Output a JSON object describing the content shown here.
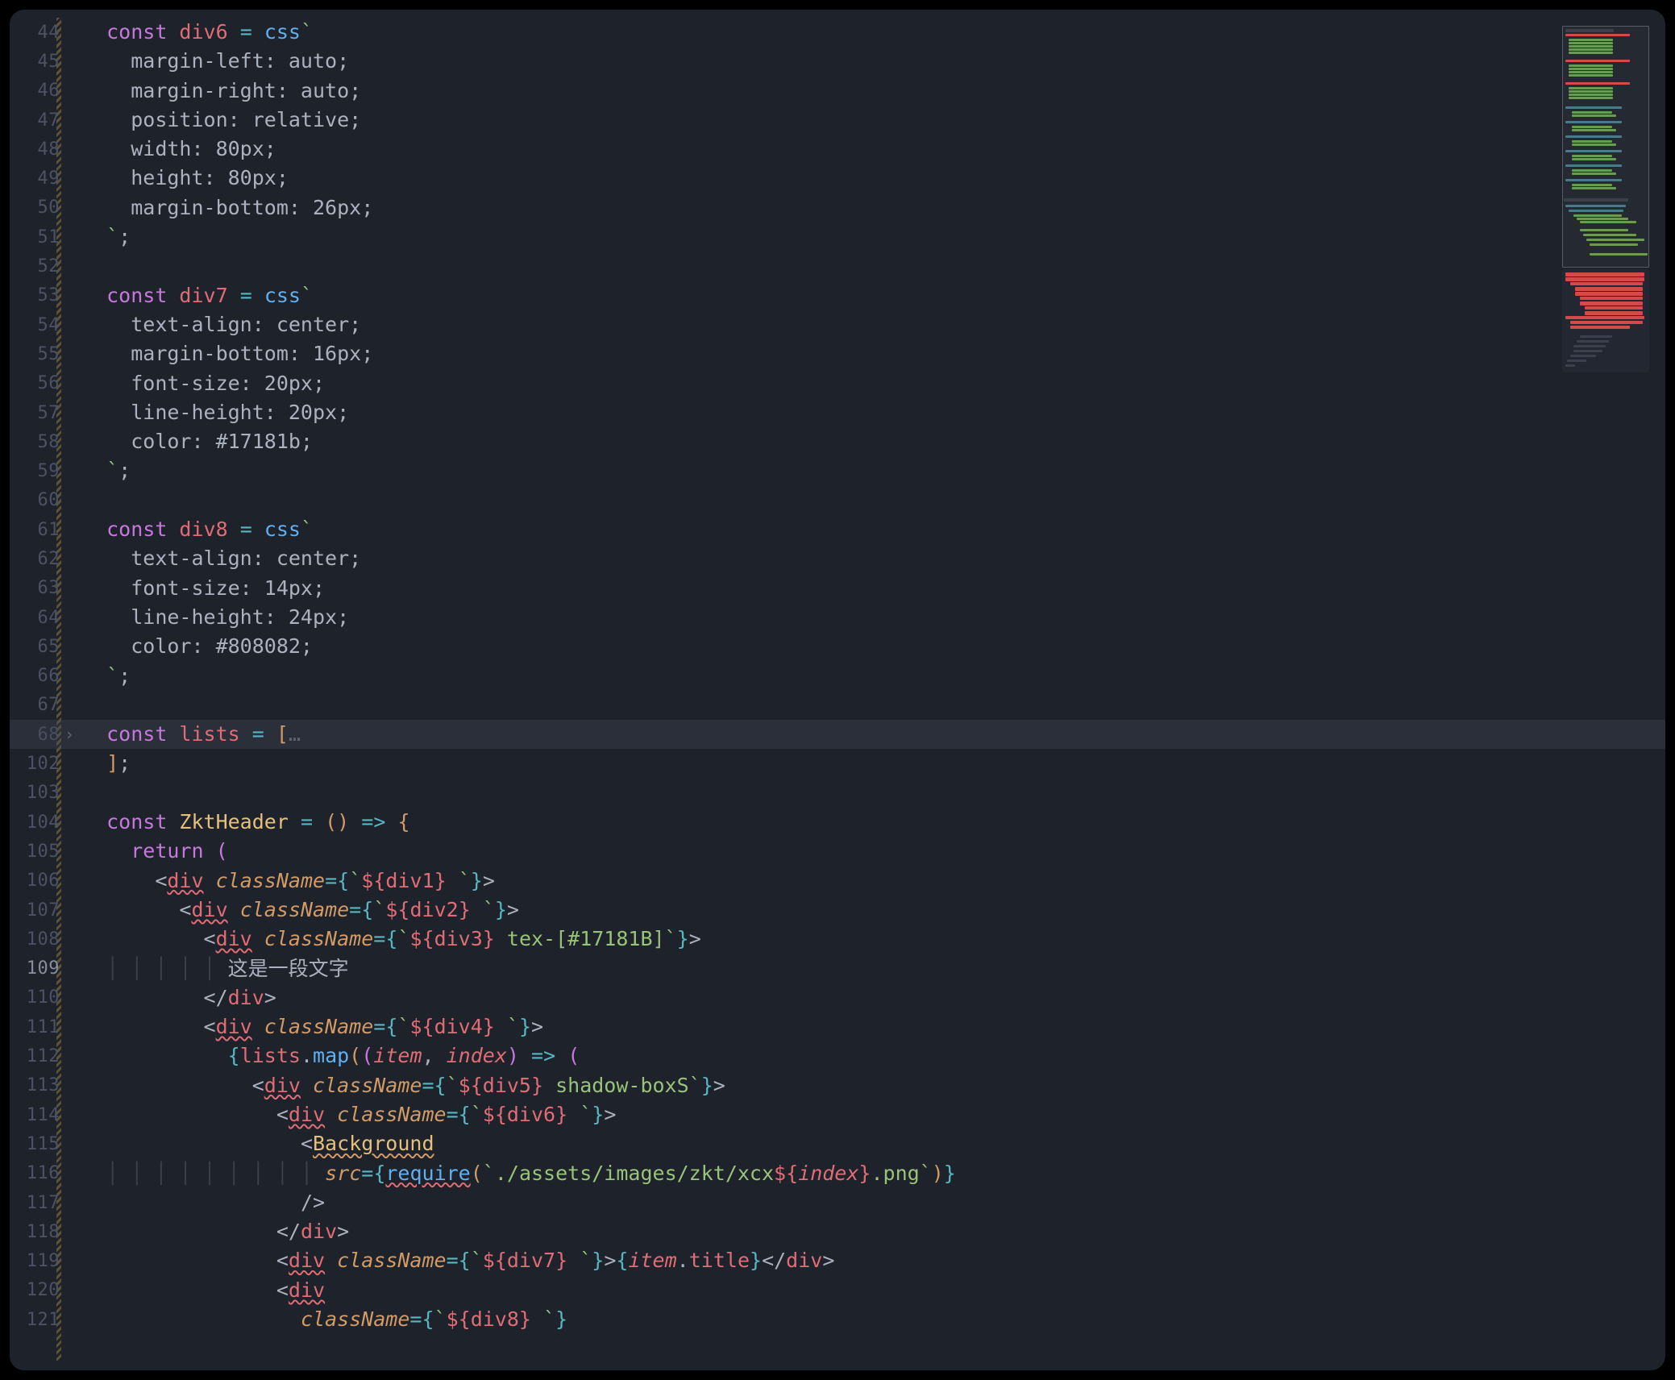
{
  "editor": {
    "first_line_number": 44,
    "active_line_number": 109,
    "lines": [
      {
        "num": "44",
        "tokens": [
          [
            "",
            "ind1"
          ],
          [
            "const ",
            "kw"
          ],
          [
            "div6",
            "var"
          ],
          [
            " ",
            "pun"
          ],
          [
            "=",
            "op"
          ],
          [
            " ",
            "pun"
          ],
          [
            "css",
            "fn"
          ],
          [
            "`",
            "str"
          ]
        ]
      },
      {
        "num": "45",
        "tokens": [
          [
            "",
            "ind2"
          ],
          [
            "margin-left: auto;",
            "plain"
          ]
        ]
      },
      {
        "num": "46",
        "tokens": [
          [
            "",
            "ind2"
          ],
          [
            "margin-right: auto;",
            "plain"
          ]
        ]
      },
      {
        "num": "47",
        "tokens": [
          [
            "",
            "ind2"
          ],
          [
            "position: relative;",
            "plain"
          ]
        ]
      },
      {
        "num": "48",
        "tokens": [
          [
            "",
            "ind2"
          ],
          [
            "width: 80px;",
            "plain"
          ]
        ]
      },
      {
        "num": "49",
        "tokens": [
          [
            "",
            "ind2"
          ],
          [
            "height: 80px;",
            "plain"
          ]
        ]
      },
      {
        "num": "50",
        "tokens": [
          [
            "",
            "ind2"
          ],
          [
            "margin-bottom: 26px;",
            "plain"
          ]
        ]
      },
      {
        "num": "51",
        "tokens": [
          [
            "",
            "ind1"
          ],
          [
            "`",
            "str"
          ],
          [
            ";",
            "pun"
          ]
        ]
      },
      {
        "num": "52",
        "tokens": []
      },
      {
        "num": "53",
        "tokens": [
          [
            "",
            "ind1"
          ],
          [
            "const ",
            "kw"
          ],
          [
            "div7",
            "var"
          ],
          [
            " ",
            "pun"
          ],
          [
            "=",
            "op"
          ],
          [
            " ",
            "pun"
          ],
          [
            "css",
            "fn"
          ],
          [
            "`",
            "str"
          ]
        ]
      },
      {
        "num": "54",
        "tokens": [
          [
            "",
            "ind2"
          ],
          [
            "text-align: center;",
            "plain"
          ]
        ]
      },
      {
        "num": "55",
        "tokens": [
          [
            "",
            "ind2"
          ],
          [
            "margin-bottom: 16px;",
            "plain"
          ]
        ]
      },
      {
        "num": "56",
        "tokens": [
          [
            "",
            "ind2"
          ],
          [
            "font-size: 20px;",
            "plain"
          ]
        ]
      },
      {
        "num": "57",
        "tokens": [
          [
            "",
            "ind2"
          ],
          [
            "line-height: 20px;",
            "plain"
          ]
        ]
      },
      {
        "num": "58",
        "tokens": [
          [
            "",
            "ind2"
          ],
          [
            "color: #17181b;",
            "plain"
          ]
        ]
      },
      {
        "num": "59",
        "tokens": [
          [
            "",
            "ind1"
          ],
          [
            "`",
            "str"
          ],
          [
            ";",
            "pun"
          ]
        ]
      },
      {
        "num": "60",
        "tokens": []
      },
      {
        "num": "61",
        "tokens": [
          [
            "",
            "ind1"
          ],
          [
            "const ",
            "kw"
          ],
          [
            "div8",
            "var"
          ],
          [
            " ",
            "pun"
          ],
          [
            "=",
            "op"
          ],
          [
            " ",
            "pun"
          ],
          [
            "css",
            "fn"
          ],
          [
            "`",
            "str"
          ]
        ]
      },
      {
        "num": "62",
        "tokens": [
          [
            "",
            "ind2"
          ],
          [
            "text-align: center;",
            "plain"
          ]
        ]
      },
      {
        "num": "63",
        "tokens": [
          [
            "",
            "ind2"
          ],
          [
            "font-size: 14px;",
            "plain"
          ]
        ]
      },
      {
        "num": "64",
        "tokens": [
          [
            "",
            "ind2"
          ],
          [
            "line-height: 24px;",
            "plain"
          ]
        ]
      },
      {
        "num": "65",
        "tokens": [
          [
            "",
            "ind2"
          ],
          [
            "color: #808082;",
            "plain"
          ]
        ]
      },
      {
        "num": "66",
        "tokens": [
          [
            "",
            "ind1"
          ],
          [
            "`",
            "str"
          ],
          [
            ";",
            "pun"
          ]
        ]
      },
      {
        "num": "67",
        "tokens": []
      },
      {
        "num": "68",
        "fold": true,
        "hl": true,
        "tokens": [
          [
            "",
            "ind1"
          ],
          [
            "const ",
            "kw"
          ],
          [
            "lists",
            "var"
          ],
          [
            " ",
            "pun"
          ],
          [
            "=",
            "op"
          ],
          [
            " ",
            "pun"
          ],
          [
            "[",
            "brk1"
          ],
          [
            "…",
            "dim"
          ]
        ]
      },
      {
        "num": "102",
        "tokens": [
          [
            "",
            "ind1"
          ],
          [
            "]",
            "brk1"
          ],
          [
            ";",
            "pun"
          ]
        ]
      },
      {
        "num": "103",
        "tokens": []
      },
      {
        "num": "104",
        "tokens": [
          [
            "",
            "ind1"
          ],
          [
            "const ",
            "kw"
          ],
          [
            "ZktHeader",
            "cmp"
          ],
          [
            " ",
            "pun"
          ],
          [
            "=",
            "op"
          ],
          [
            " ",
            "pun"
          ],
          [
            "(",
            "brk1"
          ],
          [
            ")",
            "brk1"
          ],
          [
            " ",
            "pun"
          ],
          [
            "=>",
            "op"
          ],
          [
            " ",
            "pun"
          ],
          [
            "{",
            "brk1"
          ]
        ]
      },
      {
        "num": "105",
        "tokens": [
          [
            "",
            "ind2"
          ],
          [
            "return ",
            "kw"
          ],
          [
            "(",
            "brk2"
          ]
        ]
      },
      {
        "num": "106",
        "tokens": [
          [
            "",
            "ind3"
          ],
          [
            "<",
            "pun"
          ],
          [
            "div",
            "var err"
          ],
          [
            " ",
            "pun"
          ],
          [
            "className",
            "attr it"
          ],
          [
            "=",
            "op"
          ],
          [
            "{",
            "brk3"
          ],
          [
            "`",
            "str"
          ],
          [
            "${",
            "var"
          ],
          [
            "div1",
            "var"
          ],
          [
            "}",
            "var"
          ],
          [
            " `",
            "str"
          ],
          [
            "}",
            "brk3"
          ],
          [
            ">",
            "pun"
          ]
        ]
      },
      {
        "num": "107",
        "tokens": [
          [
            "",
            "ind4"
          ],
          [
            "<",
            "pun"
          ],
          [
            "div",
            "var err"
          ],
          [
            " ",
            "pun"
          ],
          [
            "className",
            "attr it"
          ],
          [
            "=",
            "op"
          ],
          [
            "{",
            "brk3"
          ],
          [
            "`",
            "str"
          ],
          [
            "${",
            "var"
          ],
          [
            "div2",
            "var"
          ],
          [
            "}",
            "var"
          ],
          [
            " `",
            "str"
          ],
          [
            "}",
            "brk3"
          ],
          [
            ">",
            "pun"
          ]
        ]
      },
      {
        "num": "108",
        "tokens": [
          [
            "",
            "ind5"
          ],
          [
            "<",
            "pun"
          ],
          [
            "div",
            "var err"
          ],
          [
            " ",
            "pun"
          ],
          [
            "className",
            "attr it"
          ],
          [
            "=",
            "op"
          ],
          [
            "{",
            "brk3"
          ],
          [
            "`",
            "str"
          ],
          [
            "${",
            "var"
          ],
          [
            "div3",
            "var"
          ],
          [
            "}",
            "var"
          ],
          [
            " tex-[#17181B]`",
            "str"
          ],
          [
            "}",
            "brk3"
          ],
          [
            ">",
            "pun"
          ]
        ]
      },
      {
        "num": "109",
        "active": true,
        "tokens": [
          [
            "",
            "ind6g"
          ],
          [
            "这是一段文字",
            "txt"
          ]
        ]
      },
      {
        "num": "110",
        "tokens": [
          [
            "",
            "ind5"
          ],
          [
            "</",
            "pun"
          ],
          [
            "div",
            "var"
          ],
          [
            ">",
            "pun"
          ]
        ]
      },
      {
        "num": "111",
        "tokens": [
          [
            "",
            "ind5"
          ],
          [
            "<",
            "pun"
          ],
          [
            "div",
            "var err"
          ],
          [
            " ",
            "pun"
          ],
          [
            "className",
            "attr it"
          ],
          [
            "=",
            "op"
          ],
          [
            "{",
            "brk3"
          ],
          [
            "`",
            "str"
          ],
          [
            "${",
            "var"
          ],
          [
            "div4",
            "var"
          ],
          [
            "}",
            "var"
          ],
          [
            " `",
            "str"
          ],
          [
            "}",
            "brk3"
          ],
          [
            ">",
            "pun"
          ]
        ]
      },
      {
        "num": "112",
        "tokens": [
          [
            "",
            "ind6"
          ],
          [
            "{",
            "brk3"
          ],
          [
            "lists",
            "var"
          ],
          [
            ".",
            "pun"
          ],
          [
            "map",
            "fn"
          ],
          [
            "(",
            "brk1"
          ],
          [
            "(",
            "brk2"
          ],
          [
            "item",
            "var it"
          ],
          [
            ", ",
            "pun"
          ],
          [
            "index",
            "var it"
          ],
          [
            ")",
            "brk2"
          ],
          [
            " ",
            "pun"
          ],
          [
            "=>",
            "op"
          ],
          [
            " ",
            "pun"
          ],
          [
            "(",
            "brk2"
          ]
        ]
      },
      {
        "num": "113",
        "tokens": [
          [
            "",
            "ind7"
          ],
          [
            "<",
            "pun"
          ],
          [
            "div",
            "var err"
          ],
          [
            " ",
            "pun"
          ],
          [
            "className",
            "attr it"
          ],
          [
            "=",
            "op"
          ],
          [
            "{",
            "brk3"
          ],
          [
            "`",
            "str"
          ],
          [
            "${",
            "var"
          ],
          [
            "div5",
            "var"
          ],
          [
            "}",
            "var"
          ],
          [
            " shadow-boxS`",
            "str"
          ],
          [
            "}",
            "brk3"
          ],
          [
            ">",
            "pun"
          ]
        ]
      },
      {
        "num": "114",
        "tokens": [
          [
            "",
            "ind8"
          ],
          [
            "<",
            "pun"
          ],
          [
            "div",
            "var err"
          ],
          [
            " ",
            "pun"
          ],
          [
            "className",
            "attr it"
          ],
          [
            "=",
            "op"
          ],
          [
            "{",
            "brk3"
          ],
          [
            "`",
            "str"
          ],
          [
            "${",
            "var"
          ],
          [
            "div6",
            "var"
          ],
          [
            "}",
            "var"
          ],
          [
            " `",
            "str"
          ],
          [
            "}",
            "brk3"
          ],
          [
            ">",
            "pun"
          ]
        ]
      },
      {
        "num": "115",
        "tokens": [
          [
            "",
            "ind9"
          ],
          [
            "<",
            "pun"
          ],
          [
            "Background",
            "cmp err2"
          ]
        ]
      },
      {
        "num": "116",
        "tokens": [
          [
            "",
            "ind10g"
          ],
          [
            "src",
            "attr it"
          ],
          [
            "=",
            "op"
          ],
          [
            "{",
            "brk3"
          ],
          [
            "require",
            "fn err"
          ],
          [
            "(",
            "brk1"
          ],
          [
            "`./assets/images/zkt/xcx",
            "str"
          ],
          [
            "${",
            "var"
          ],
          [
            "index",
            "var it"
          ],
          [
            "}",
            "var"
          ],
          [
            ".png`",
            "str"
          ],
          [
            ")",
            "brk1"
          ],
          [
            "}",
            "brk3"
          ]
        ]
      },
      {
        "num": "117",
        "tokens": [
          [
            "",
            "ind9"
          ],
          [
            "/>",
            "pun"
          ]
        ]
      },
      {
        "num": "118",
        "tokens": [
          [
            "",
            "ind8"
          ],
          [
            "</",
            "pun"
          ],
          [
            "div",
            "var"
          ],
          [
            ">",
            "pun"
          ]
        ]
      },
      {
        "num": "119",
        "tokens": [
          [
            "",
            "ind8"
          ],
          [
            "<",
            "pun"
          ],
          [
            "div",
            "var err"
          ],
          [
            " ",
            "pun"
          ],
          [
            "className",
            "attr it"
          ],
          [
            "=",
            "op"
          ],
          [
            "{",
            "brk3"
          ],
          [
            "`",
            "str"
          ],
          [
            "${",
            "var"
          ],
          [
            "div7",
            "var"
          ],
          [
            "}",
            "var"
          ],
          [
            " `",
            "str"
          ],
          [
            "}",
            "brk3"
          ],
          [
            ">",
            "pun"
          ],
          [
            "{",
            "brk3"
          ],
          [
            "item",
            "var it"
          ],
          [
            ".",
            "pun"
          ],
          [
            "title",
            "var"
          ],
          [
            "}",
            "brk3"
          ],
          [
            "</",
            "pun"
          ],
          [
            "div",
            "var"
          ],
          [
            ">",
            "pun"
          ]
        ]
      },
      {
        "num": "120",
        "tokens": [
          [
            "",
            "ind8"
          ],
          [
            "<",
            "pun"
          ],
          [
            "div",
            "var err"
          ]
        ]
      },
      {
        "num": "121",
        "tokens": [
          [
            "",
            "ind9"
          ],
          [
            "className",
            "attr it"
          ],
          [
            "=",
            "op"
          ],
          [
            "{",
            "brk3"
          ],
          [
            "`",
            "str"
          ],
          [
            "${",
            "var"
          ],
          [
            "div8",
            "var"
          ],
          [
            "}",
            "var"
          ],
          [
            " `",
            "str"
          ],
          [
            "}",
            "brk3"
          ]
        ]
      }
    ]
  }
}
